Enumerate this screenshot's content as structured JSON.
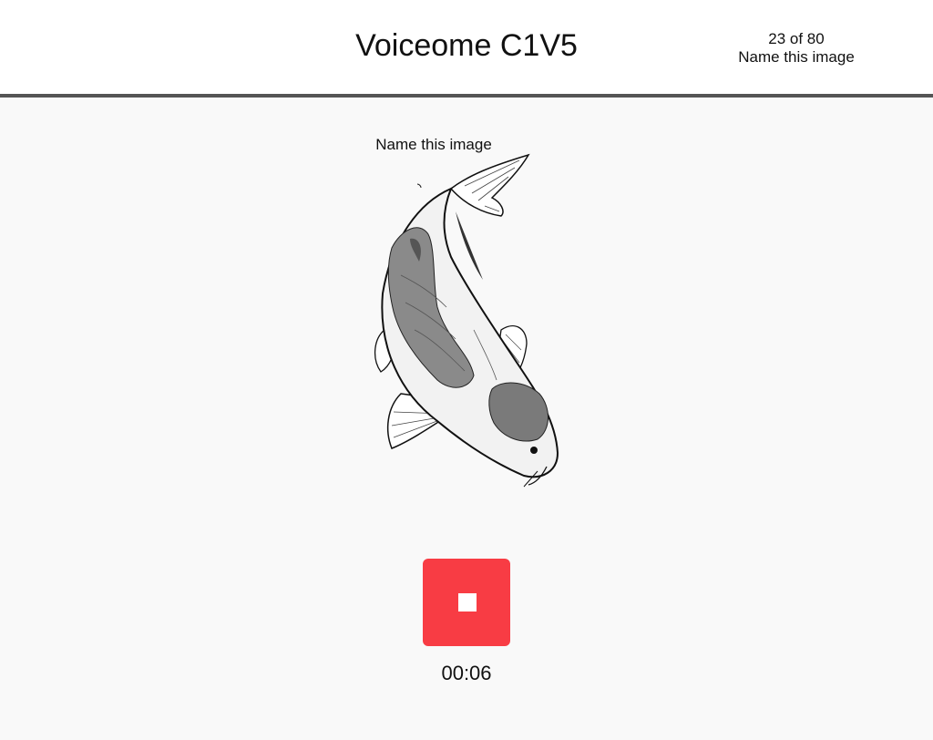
{
  "header": {
    "title": "Voiceome C1V5",
    "progress_count": "23 of 80",
    "progress_task": "Name this image"
  },
  "main": {
    "prompt": "Name this image",
    "image_icon": "koi-fish-illustration",
    "timer": "00:06"
  },
  "controls": {
    "stop_icon": "stop-square-icon"
  },
  "colors": {
    "header_bg": "#ffffff",
    "header_border": "#555555",
    "page_bg": "#f9f9f9",
    "record_button": "#f83c44"
  }
}
